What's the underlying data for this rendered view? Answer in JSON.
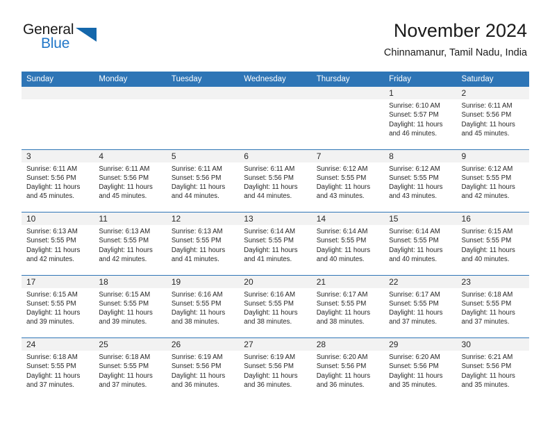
{
  "brand": {
    "name_top": "General",
    "name_bottom": "Blue",
    "accent_color": "#2277c8",
    "triangle_color": "#1467ab"
  },
  "header": {
    "title": "November 2024",
    "subtitle": "Chinnamanur, Tamil Nadu, India"
  },
  "theme": {
    "header_bg": "#2e75b6",
    "daynum_bg": "#f2f2f2",
    "text_color": "#262626"
  },
  "weekday_headers": [
    "Sunday",
    "Monday",
    "Tuesday",
    "Wednesday",
    "Thursday",
    "Friday",
    "Saturday"
  ],
  "weeks": [
    [
      {
        "day": "",
        "empty": true
      },
      {
        "day": "",
        "empty": true
      },
      {
        "day": "",
        "empty": true
      },
      {
        "day": "",
        "empty": true
      },
      {
        "day": "",
        "empty": true
      },
      {
        "day": "1",
        "sunrise": "Sunrise: 6:10 AM",
        "sunset": "Sunset: 5:57 PM",
        "daylight_1": "Daylight: 11 hours",
        "daylight_2": "and 46 minutes."
      },
      {
        "day": "2",
        "sunrise": "Sunrise: 6:11 AM",
        "sunset": "Sunset: 5:56 PM",
        "daylight_1": "Daylight: 11 hours",
        "daylight_2": "and 45 minutes."
      }
    ],
    [
      {
        "day": "3",
        "sunrise": "Sunrise: 6:11 AM",
        "sunset": "Sunset: 5:56 PM",
        "daylight_1": "Daylight: 11 hours",
        "daylight_2": "and 45 minutes."
      },
      {
        "day": "4",
        "sunrise": "Sunrise: 6:11 AM",
        "sunset": "Sunset: 5:56 PM",
        "daylight_1": "Daylight: 11 hours",
        "daylight_2": "and 45 minutes."
      },
      {
        "day": "5",
        "sunrise": "Sunrise: 6:11 AM",
        "sunset": "Sunset: 5:56 PM",
        "daylight_1": "Daylight: 11 hours",
        "daylight_2": "and 44 minutes."
      },
      {
        "day": "6",
        "sunrise": "Sunrise: 6:11 AM",
        "sunset": "Sunset: 5:56 PM",
        "daylight_1": "Daylight: 11 hours",
        "daylight_2": "and 44 minutes."
      },
      {
        "day": "7",
        "sunrise": "Sunrise: 6:12 AM",
        "sunset": "Sunset: 5:55 PM",
        "daylight_1": "Daylight: 11 hours",
        "daylight_2": "and 43 minutes."
      },
      {
        "day": "8",
        "sunrise": "Sunrise: 6:12 AM",
        "sunset": "Sunset: 5:55 PM",
        "daylight_1": "Daylight: 11 hours",
        "daylight_2": "and 43 minutes."
      },
      {
        "day": "9",
        "sunrise": "Sunrise: 6:12 AM",
        "sunset": "Sunset: 5:55 PM",
        "daylight_1": "Daylight: 11 hours",
        "daylight_2": "and 42 minutes."
      }
    ],
    [
      {
        "day": "10",
        "sunrise": "Sunrise: 6:13 AM",
        "sunset": "Sunset: 5:55 PM",
        "daylight_1": "Daylight: 11 hours",
        "daylight_2": "and 42 minutes."
      },
      {
        "day": "11",
        "sunrise": "Sunrise: 6:13 AM",
        "sunset": "Sunset: 5:55 PM",
        "daylight_1": "Daylight: 11 hours",
        "daylight_2": "and 42 minutes."
      },
      {
        "day": "12",
        "sunrise": "Sunrise: 6:13 AM",
        "sunset": "Sunset: 5:55 PM",
        "daylight_1": "Daylight: 11 hours",
        "daylight_2": "and 41 minutes."
      },
      {
        "day": "13",
        "sunrise": "Sunrise: 6:14 AM",
        "sunset": "Sunset: 5:55 PM",
        "daylight_1": "Daylight: 11 hours",
        "daylight_2": "and 41 minutes."
      },
      {
        "day": "14",
        "sunrise": "Sunrise: 6:14 AM",
        "sunset": "Sunset: 5:55 PM",
        "daylight_1": "Daylight: 11 hours",
        "daylight_2": "and 40 minutes."
      },
      {
        "day": "15",
        "sunrise": "Sunrise: 6:14 AM",
        "sunset": "Sunset: 5:55 PM",
        "daylight_1": "Daylight: 11 hours",
        "daylight_2": "and 40 minutes."
      },
      {
        "day": "16",
        "sunrise": "Sunrise: 6:15 AM",
        "sunset": "Sunset: 5:55 PM",
        "daylight_1": "Daylight: 11 hours",
        "daylight_2": "and 40 minutes."
      }
    ],
    [
      {
        "day": "17",
        "sunrise": "Sunrise: 6:15 AM",
        "sunset": "Sunset: 5:55 PM",
        "daylight_1": "Daylight: 11 hours",
        "daylight_2": "and 39 minutes."
      },
      {
        "day": "18",
        "sunrise": "Sunrise: 6:15 AM",
        "sunset": "Sunset: 5:55 PM",
        "daylight_1": "Daylight: 11 hours",
        "daylight_2": "and 39 minutes."
      },
      {
        "day": "19",
        "sunrise": "Sunrise: 6:16 AM",
        "sunset": "Sunset: 5:55 PM",
        "daylight_1": "Daylight: 11 hours",
        "daylight_2": "and 38 minutes."
      },
      {
        "day": "20",
        "sunrise": "Sunrise: 6:16 AM",
        "sunset": "Sunset: 5:55 PM",
        "daylight_1": "Daylight: 11 hours",
        "daylight_2": "and 38 minutes."
      },
      {
        "day": "21",
        "sunrise": "Sunrise: 6:17 AM",
        "sunset": "Sunset: 5:55 PM",
        "daylight_1": "Daylight: 11 hours",
        "daylight_2": "and 38 minutes."
      },
      {
        "day": "22",
        "sunrise": "Sunrise: 6:17 AM",
        "sunset": "Sunset: 5:55 PM",
        "daylight_1": "Daylight: 11 hours",
        "daylight_2": "and 37 minutes."
      },
      {
        "day": "23",
        "sunrise": "Sunrise: 6:18 AM",
        "sunset": "Sunset: 5:55 PM",
        "daylight_1": "Daylight: 11 hours",
        "daylight_2": "and 37 minutes."
      }
    ],
    [
      {
        "day": "24",
        "sunrise": "Sunrise: 6:18 AM",
        "sunset": "Sunset: 5:55 PM",
        "daylight_1": "Daylight: 11 hours",
        "daylight_2": "and 37 minutes."
      },
      {
        "day": "25",
        "sunrise": "Sunrise: 6:18 AM",
        "sunset": "Sunset: 5:55 PM",
        "daylight_1": "Daylight: 11 hours",
        "daylight_2": "and 37 minutes."
      },
      {
        "day": "26",
        "sunrise": "Sunrise: 6:19 AM",
        "sunset": "Sunset: 5:56 PM",
        "daylight_1": "Daylight: 11 hours",
        "daylight_2": "and 36 minutes."
      },
      {
        "day": "27",
        "sunrise": "Sunrise: 6:19 AM",
        "sunset": "Sunset: 5:56 PM",
        "daylight_1": "Daylight: 11 hours",
        "daylight_2": "and 36 minutes."
      },
      {
        "day": "28",
        "sunrise": "Sunrise: 6:20 AM",
        "sunset": "Sunset: 5:56 PM",
        "daylight_1": "Daylight: 11 hours",
        "daylight_2": "and 36 minutes."
      },
      {
        "day": "29",
        "sunrise": "Sunrise: 6:20 AM",
        "sunset": "Sunset: 5:56 PM",
        "daylight_1": "Daylight: 11 hours",
        "daylight_2": "and 35 minutes."
      },
      {
        "day": "30",
        "sunrise": "Sunrise: 6:21 AM",
        "sunset": "Sunset: 5:56 PM",
        "daylight_1": "Daylight: 11 hours",
        "daylight_2": "and 35 minutes."
      }
    ]
  ]
}
